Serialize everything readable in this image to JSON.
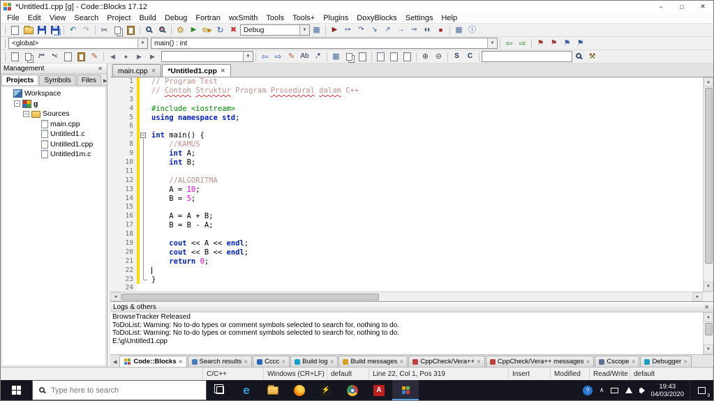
{
  "window": {
    "title": "*Untitled1.cpp [g] - Code::Blocks 17.12"
  },
  "menu": {
    "items": [
      "File",
      "Edit",
      "View",
      "Search",
      "Project",
      "Build",
      "Debug",
      "Fortran",
      "wxSmith",
      "Tools",
      "Tools+",
      "Plugins",
      "DoxyBlocks",
      "Settings",
      "Help"
    ]
  },
  "icons": {
    "minimize": "−",
    "maximize": "□",
    "close": "✕",
    "undo": "↶",
    "redo": "↷",
    "cut": "✂",
    "build": "⚙",
    "run": "▶",
    "build_and_run": "⚙▶",
    "rebuild": "↻",
    "abort": "✖",
    "compile_grid": "▦",
    "debug_run": "▶",
    "run_to_cursor": "↦",
    "next_line": "↷",
    "step_into": "↘",
    "step_out": "↗",
    "next_instruction": "→",
    "step_into_instruction": "⇒",
    "break_debugger": "▮▮",
    "stop_debugger": "■",
    "debugging_windows": "▦",
    "various_info": "ⓘ",
    "jump_back": "⇦",
    "jump_forward": "⇨",
    "flag": "⚑",
    "doxy_block_comment": "/**",
    "doxy_line_comment": "*<",
    "pencil": "✎",
    "regex_ab": "Ab",
    "regex_star": ".*",
    "zoom_in": "⊕",
    "zoom_out": "⊖",
    "letter_s": "S",
    "letter_c": "C",
    "hammer": "⚒",
    "left_arrow": "◄",
    "right_arrow": "►",
    "up_arrow": "▲",
    "down_arrow": "▼",
    "prev": "◀",
    "next": "▶",
    "record": "●",
    "chevron_up": "∧",
    "help": "?"
  },
  "toolbars": {
    "build_target": "Debug",
    "scope": "<global>",
    "symbol": "main() : int",
    "fortran_combo": "",
    "search_value": ""
  },
  "management": {
    "title": "Management",
    "tabs": [
      "Projects",
      "Symbols",
      "Files"
    ],
    "active_tab": "Projects",
    "tree": [
      {
        "label": "Workspace",
        "depth": 0,
        "icon": "workspace",
        "expand": false,
        "bold": false
      },
      {
        "label": "g",
        "depth": 1,
        "icon": "project",
        "expand": true,
        "bold": true
      },
      {
        "label": "Sources",
        "depth": 2,
        "icon": "folder",
        "expand": true,
        "bold": false
      },
      {
        "label": "main.cpp",
        "depth": 3,
        "icon": "file",
        "expand": false,
        "bold": false
      },
      {
        "label": "Untitled1.c",
        "depth": 3,
        "icon": "file",
        "expand": false,
        "bold": false
      },
      {
        "label": "Untitled1.cpp",
        "depth": 3,
        "icon": "file",
        "expand": false,
        "bold": false
      },
      {
        "label": "Untitled1m.c",
        "depth": 3,
        "icon": "file",
        "expand": false,
        "bold": false
      }
    ]
  },
  "editor": {
    "tabs": [
      {
        "label": "main.cpp",
        "active": false
      },
      {
        "label": "*Untitled1.cpp",
        "active": true
      }
    ],
    "lines": [
      {
        "n": 1,
        "chg": true,
        "fold": "",
        "caret": false,
        "seg": [
          {
            "t": "// Program Test",
            "s": "c"
          }
        ]
      },
      {
        "n": 2,
        "chg": true,
        "fold": "",
        "caret": false,
        "seg": [
          {
            "t": "// ",
            "s": "c"
          },
          {
            "t": "Contoh",
            "s": "csp"
          },
          {
            "t": " ",
            "s": "c"
          },
          {
            "t": "Struktur",
            "s": "csp"
          },
          {
            "t": " Program ",
            "s": "c"
          },
          {
            "t": "Prosedural",
            "s": "csp"
          },
          {
            "t": " ",
            "s": "c"
          },
          {
            "t": "dalam",
            "s": "csp"
          },
          {
            "t": " C++",
            "s": "c"
          }
        ]
      },
      {
        "n": 3,
        "chg": true,
        "fold": "",
        "caret": false,
        "seg": []
      },
      {
        "n": 4,
        "chg": true,
        "fold": "",
        "caret": false,
        "seg": [
          {
            "t": "#include <iostream>",
            "s": "p"
          }
        ]
      },
      {
        "n": 5,
        "chg": true,
        "fold": "",
        "caret": false,
        "seg": [
          {
            "t": "using namespace std",
            "s": "k"
          },
          {
            "t": ";",
            "s": "t"
          }
        ]
      },
      {
        "n": 6,
        "chg": true,
        "fold": "",
        "caret": false,
        "seg": []
      },
      {
        "n": 7,
        "chg": true,
        "fold": "start",
        "caret": false,
        "seg": [
          {
            "t": "int",
            "s": "k"
          },
          {
            "t": " main() {",
            "s": "t"
          }
        ]
      },
      {
        "n": 8,
        "chg": true,
        "fold": "mid",
        "caret": false,
        "seg": [
          {
            "t": "    ",
            "s": "t"
          },
          {
            "t": "//KAMUS",
            "s": "c"
          }
        ]
      },
      {
        "n": 9,
        "chg": true,
        "fold": "mid",
        "caret": false,
        "seg": [
          {
            "t": "    ",
            "s": "t"
          },
          {
            "t": "int",
            "s": "k"
          },
          {
            "t": " A;",
            "s": "t"
          }
        ]
      },
      {
        "n": 10,
        "chg": true,
        "fold": "mid",
        "caret": false,
        "seg": [
          {
            "t": "    ",
            "s": "t"
          },
          {
            "t": "int",
            "s": "k"
          },
          {
            "t": " B;",
            "s": "t"
          }
        ]
      },
      {
        "n": 11,
        "chg": true,
        "fold": "mid",
        "caret": false,
        "seg": []
      },
      {
        "n": 12,
        "chg": true,
        "fold": "mid",
        "caret": false,
        "seg": [
          {
            "t": "    ",
            "s": "t"
          },
          {
            "t": "//ALGORITMA",
            "s": "c"
          }
        ]
      },
      {
        "n": 13,
        "chg": true,
        "fold": "mid",
        "caret": false,
        "seg": [
          {
            "t": "    A = ",
            "s": "t"
          },
          {
            "t": "10",
            "s": "n"
          },
          {
            "t": ";",
            "s": "t"
          }
        ]
      },
      {
        "n": 14,
        "chg": true,
        "fold": "mid",
        "caret": false,
        "seg": [
          {
            "t": "    B = ",
            "s": "t"
          },
          {
            "t": "5",
            "s": "n"
          },
          {
            "t": ";",
            "s": "t"
          }
        ]
      },
      {
        "n": 15,
        "chg": true,
        "fold": "mid",
        "caret": false,
        "seg": []
      },
      {
        "n": 16,
        "chg": true,
        "fold": "mid",
        "caret": false,
        "seg": [
          {
            "t": "    A = A + B;",
            "s": "t"
          }
        ]
      },
      {
        "n": 17,
        "chg": true,
        "fold": "mid",
        "caret": false,
        "seg": [
          {
            "t": "    B = B - A;",
            "s": "t"
          }
        ]
      },
      {
        "n": 18,
        "chg": true,
        "fold": "mid",
        "caret": false,
        "seg": []
      },
      {
        "n": 19,
        "chg": true,
        "fold": "mid",
        "caret": false,
        "seg": [
          {
            "t": "    ",
            "s": "t"
          },
          {
            "t": "cout",
            "s": "k"
          },
          {
            "t": " << A << ",
            "s": "t"
          },
          {
            "t": "endl",
            "s": "k"
          },
          {
            "t": ";",
            "s": "t"
          }
        ]
      },
      {
        "n": 20,
        "chg": true,
        "fold": "mid",
        "caret": false,
        "seg": [
          {
            "t": "    ",
            "s": "t"
          },
          {
            "t": "cout",
            "s": "k"
          },
          {
            "t": " << B << ",
            "s": "t"
          },
          {
            "t": "endl",
            "s": "k"
          },
          {
            "t": ";",
            "s": "t"
          }
        ]
      },
      {
        "n": 21,
        "chg": true,
        "fold": "mid",
        "caret": false,
        "seg": [
          {
            "t": "    ",
            "s": "t"
          },
          {
            "t": "return",
            "s": "k"
          },
          {
            "t": " ",
            "s": "t"
          },
          {
            "t": "0",
            "s": "n"
          },
          {
            "t": ";",
            "s": "t"
          }
        ]
      },
      {
        "n": 22,
        "chg": true,
        "fold": "mid",
        "caret": true,
        "seg": []
      },
      {
        "n": 23,
        "chg": true,
        "fold": "end",
        "caret": false,
        "seg": [
          {
            "t": "}",
            "s": "t"
          }
        ]
      },
      {
        "n": 24,
        "chg": false,
        "fold": "",
        "caret": false,
        "seg": []
      }
    ]
  },
  "logs": {
    "title": "Logs & others",
    "lines": [
      "BrowseTracker Released",
      "ToDoList: Warning: No to-do types or comment symbols selected to search for, nothing to do.",
      "ToDoList: Warning: No to-do types or comment symbols selected to search for, nothing to do.",
      "E:\\g\\Untitled1.cpp"
    ]
  },
  "bottom_tabs": [
    {
      "label": "Code::Blocks",
      "active": true,
      "icon": "cb"
    },
    {
      "label": "Search results",
      "active": false,
      "icon": "#4a7ebb"
    },
    {
      "label": "Cccc",
      "active": false,
      "icon": "#2b66b8"
    },
    {
      "label": "Build log",
      "active": false,
      "icon": "#18a0c4"
    },
    {
      "label": "Build messages",
      "active": false,
      "icon": "#d8a020"
    },
    {
      "label": "CppCheck/Vera++",
      "active": false,
      "icon": "#c04040"
    },
    {
      "label": "CppCheck/Vera++ messages",
      "active": false,
      "icon": "#c04040"
    },
    {
      "label": "Cscope",
      "active": false,
      "icon": "#607090"
    },
    {
      "label": "Debugger",
      "active": false,
      "icon": "#18a0c4"
    }
  ],
  "statusbar": {
    "items": [
      "",
      "C/C++",
      "Windows (CR+LF)",
      "default",
      "Line 22, Col 1, Pos 319",
      "Insert",
      "Modified",
      "Read/Write",
      "default"
    ]
  },
  "taskbar": {
    "search_placeholder": "Type here to search",
    "time": "19:43",
    "date": "04/03/2020",
    "badge": "3"
  }
}
